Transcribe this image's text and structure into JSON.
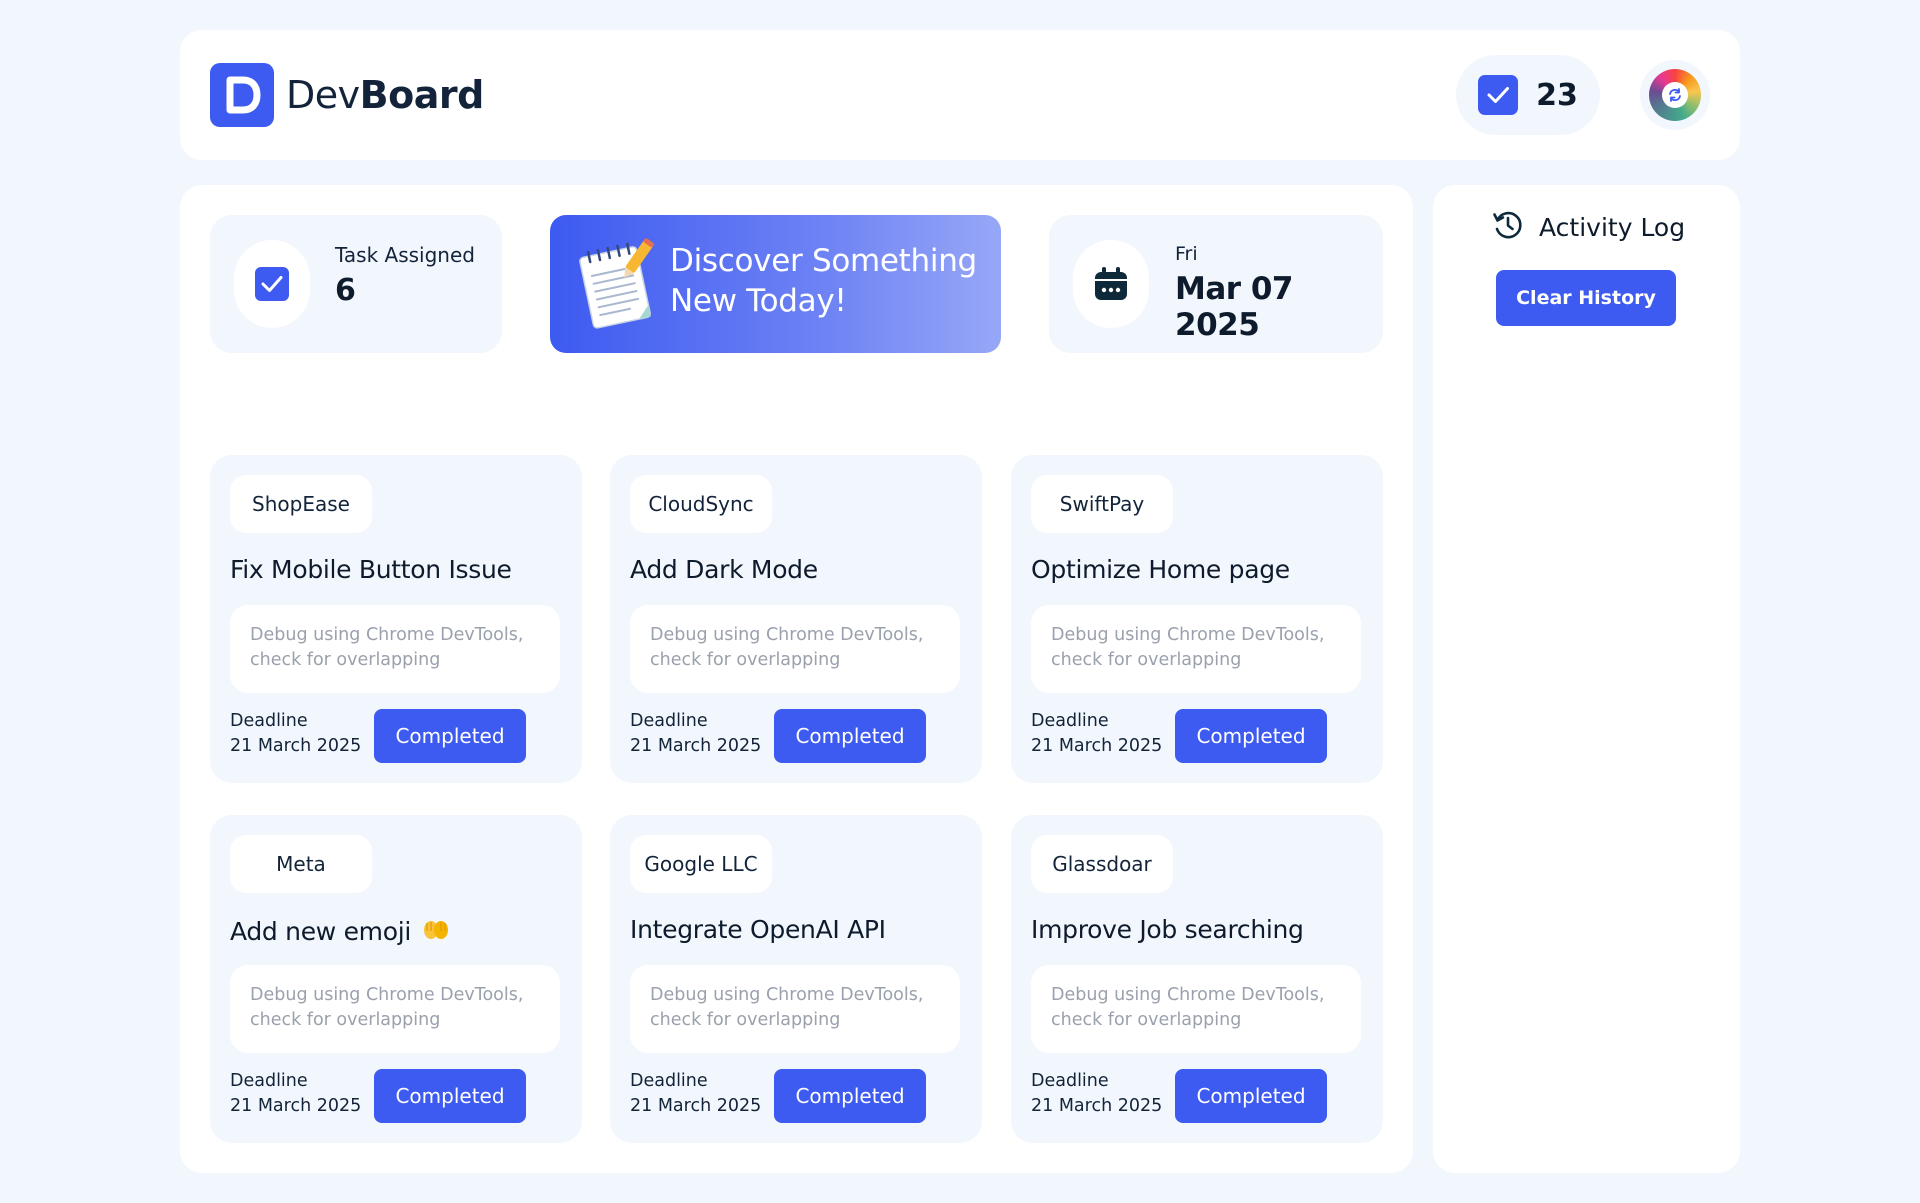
{
  "header": {
    "brand_light": "Dev",
    "brand_bold": "Board",
    "completed_count": "23"
  },
  "stats": {
    "task_label": "Task Assigned",
    "task_value": "6",
    "day": "Fri",
    "date": "Mar 07 2025"
  },
  "promo": {
    "text": "Discover Something New Today!"
  },
  "tasks": [
    {
      "company": "ShopEase",
      "title": "Fix Mobile Button Issue",
      "description": "Debug using Chrome DevTools, check for overlapping",
      "deadline_label": "Deadline",
      "deadline": "21 March 2025",
      "status": "Completed"
    },
    {
      "company": "CloudSync",
      "title": "Add Dark Mode",
      "description": "Debug using Chrome DevTools, check for overlapping",
      "deadline_label": "Deadline",
      "deadline": "21 March 2025",
      "status": "Completed"
    },
    {
      "company": "SwiftPay",
      "title": "Optimize Home page",
      "description": "Debug using Chrome DevTools, check for overlapping",
      "deadline_label": "Deadline",
      "deadline": "21 March 2025",
      "status": "Completed"
    },
    {
      "company": "Meta",
      "title": "Add new emoji",
      "description": "Debug using Chrome DevTools, check for overlapping",
      "deadline_label": "Deadline",
      "deadline": "21 March 2025",
      "status": "Completed"
    },
    {
      "company": "Google LLC",
      "title": "Integrate OpenAI API",
      "description": "Debug using Chrome DevTools, check for overlapping",
      "deadline_label": "Deadline",
      "deadline": "21 March 2025",
      "status": "Completed"
    },
    {
      "company": "Glassdoar",
      "title": "Improve Job searching",
      "description": "Debug using Chrome DevTools, check for overlapping",
      "deadline_label": "Deadline",
      "deadline": "21 March 2025",
      "status": "Completed"
    }
  ],
  "activity": {
    "title": "Activity Log",
    "clear_label": "Clear History"
  },
  "colors": {
    "accent": "#3d5af1",
    "background": "#f2f6fd",
    "panel": "#ffffff",
    "text_dark": "#0e1b2c",
    "text_muted": "#9aa1ad"
  },
  "icons": {
    "logo": "devboard-logo-icon",
    "count": "checkbox-icon",
    "avatar": "color-wheel-icon",
    "task": "checkbox-icon",
    "promo": "notepad-icon",
    "date": "calendar-icon",
    "activity": "history-icon",
    "emoji": "clapping-hands-emoji"
  }
}
